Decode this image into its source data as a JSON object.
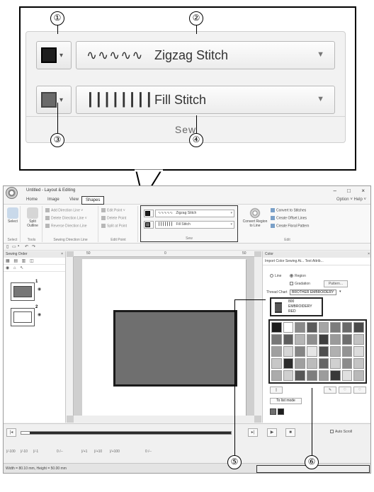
{
  "callout": {
    "numbers": [
      "①",
      "②",
      "③",
      "④",
      "⑤",
      "⑥"
    ],
    "row1": {
      "symbol": "∿∿∿∿∿",
      "label": "Zigzag Stitch"
    },
    "row2": {
      "symbol": "┃┃┃┃┃┃┃┃",
      "label": "Fill Stitch"
    },
    "group": "Sew"
  },
  "app": {
    "title": "Untitled - Layout & Editing",
    "context_tab": "Shapes",
    "tabs": [
      "Home",
      "Image",
      "View"
    ],
    "shapes_tab": "Shapes",
    "help": "Option ˅ Help ˅",
    "ribbon": {
      "select_label": "Select",
      "split_outline_label": "Split Outline",
      "groups": {
        "select": "Select",
        "tools": "Tools",
        "sewing_direction": "Sewing Direction Line",
        "edit_point": "Edit Point",
        "sew": "Sew",
        "edit": "Edit"
      },
      "direction_items": [
        "Add Direction Line ˅",
        "Delete Direction Line ˅",
        "Reverse Direction Line"
      ],
      "edit_point_items": [
        "Edit Point ˅",
        "Delete Point",
        "Split at Point"
      ],
      "sew_row1": {
        "symbol": "∿∿∿∿∿",
        "label": "Zigzag Stitch"
      },
      "sew_row2": {
        "symbol": "┃┃┃┃┃┃┃",
        "label": "Fill Stitch"
      },
      "convert_label": "Convert Region to Line",
      "edit_items": [
        "Convert to Stitches",
        "Create Offset Lines",
        "Create Floral Pattern"
      ]
    },
    "sewing_order_panel": {
      "title": "Sewing Order",
      "layer_numbers": [
        "1",
        "2"
      ]
    },
    "ruler_marks": [
      "50",
      "0",
      "50"
    ],
    "color_panel": {
      "title": "Color",
      "tabs": "Import   Color   Sewing At...   Text Attrib...",
      "line_label": "Line",
      "region_label": "Region",
      "gradation_label": "Gradation",
      "pattern_label": "Pattern...",
      "thread_chart_label": "Thread Chart",
      "thread_chart_value": "BROTHER EMBROIDERY",
      "thread": {
        "code": "800",
        "brand": "EMBROIDERY",
        "name": "RED"
      },
      "list_mode": "To list mode"
    },
    "bottom": {
      "autoscroll": "Auto Scroll",
      "step_controls": [
        "|/-100",
        "|/-10",
        "|/-1",
        "0 /--",
        "|/+1",
        "|/+10",
        "|/+100",
        "0 /--"
      ],
      "status": "Width = 80.10 mm, Height = 50.00 mm"
    }
  },
  "colors": {
    "frame": "#000000",
    "shape_fill": "#6f6f6f",
    "window_bg": "#f0f0f0"
  },
  "palette_grays": [
    "#1c1c1c",
    "#ffffff",
    "#8a8a8a",
    "#5a5a5a",
    "#a5a5a5",
    "#7c7c7c",
    "#6a6a6a",
    "#4a4a4a",
    "#777777",
    "#5e5e5e",
    "#b5b5b5",
    "#8e8e8e",
    "#3e3e3e",
    "#9a9a9a",
    "#6e6e6e",
    "#c2c2c2",
    "#a0a0a0",
    "#d5d5d5",
    "#858585",
    "#e5e5e5",
    "#4f4f4f",
    "#b0b0b0",
    "#939393",
    "#dcdcdc",
    "#c7c7c7",
    "#2b2b2b",
    "#9f9f9f",
    "#bcbcbc",
    "#666666",
    "#d0d0d0",
    "#8b8b8b",
    "#c4c4c4",
    "#ababab",
    "#cfcfcf",
    "#575757",
    "#7e7e7e",
    "#9c9c9c",
    "#383838",
    "#e0e0e0",
    "#b9b9b9"
  ]
}
